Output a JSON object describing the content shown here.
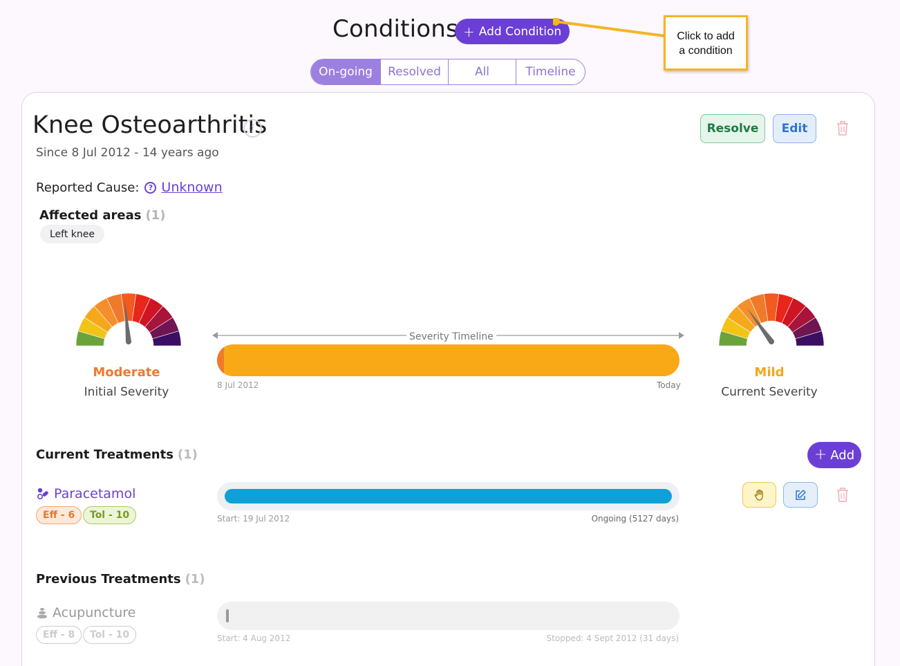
{
  "header": {
    "title": "Conditions",
    "add_button_label": "Add Condition",
    "callout_line1": "Click to add",
    "callout_line2": "a condition"
  },
  "tabs": [
    {
      "label": "On-going",
      "active": true
    },
    {
      "label": "Resolved",
      "active": false
    },
    {
      "label": "All",
      "active": false
    },
    {
      "label": "Timeline",
      "active": false
    }
  ],
  "condition": {
    "name": "Knee Osteoarthritis",
    "info_glyph": "i",
    "since": "Since 8 Jul 2012 - 14 years ago",
    "resolve_label": "Resolve",
    "edit_label": "Edit",
    "cause_label": "Reported Cause:",
    "cause_icon": "?",
    "cause_value": "Unknown",
    "areas_title": "Affected areas",
    "areas_count": "(1)",
    "areas": [
      "Left knee"
    ]
  },
  "severity": {
    "initial_label": "Moderate",
    "initial_sub": "Initial Severity",
    "initial_color": "#ef7a2c",
    "initial_level": 0.47,
    "current_label": "Mild",
    "current_sub": "Current Severity",
    "current_color": "#f5a716",
    "current_level": 0.3,
    "timeline_label": "Severity Timeline",
    "timeline_start": "8 Jul 2012",
    "timeline_end": "Today",
    "bar_color": "#f9a916"
  },
  "current_treatments": {
    "title": "Current Treatments",
    "count": "(1)",
    "add_label": "Add",
    "items": [
      {
        "name": "Paracetamol",
        "eff": "Eff - 6",
        "tol": "Tol - 10",
        "start": "Start: 19 Jul 2012",
        "end": "Ongoing (5127 days)"
      }
    ]
  },
  "previous_treatments": {
    "title": "Previous Treatments",
    "count": "(1)",
    "items": [
      {
        "name": "Acupuncture",
        "eff": "Eff - 8",
        "tol": "Tol - 10",
        "start": "Start: 4 Aug 2012",
        "end": "Stopped: 4 Sept 2012 (31 days)"
      }
    ]
  },
  "colors": {
    "accent": "#6b3fd6",
    "treatment_bar": "#0ea1d8",
    "callout_border": "#f5b526"
  },
  "icons": {
    "plus": "+",
    "trash": "trash-icon",
    "hand": "hand-icon",
    "pencil": "edit-icon",
    "pills": "pills-icon",
    "stones": "stones-icon"
  }
}
